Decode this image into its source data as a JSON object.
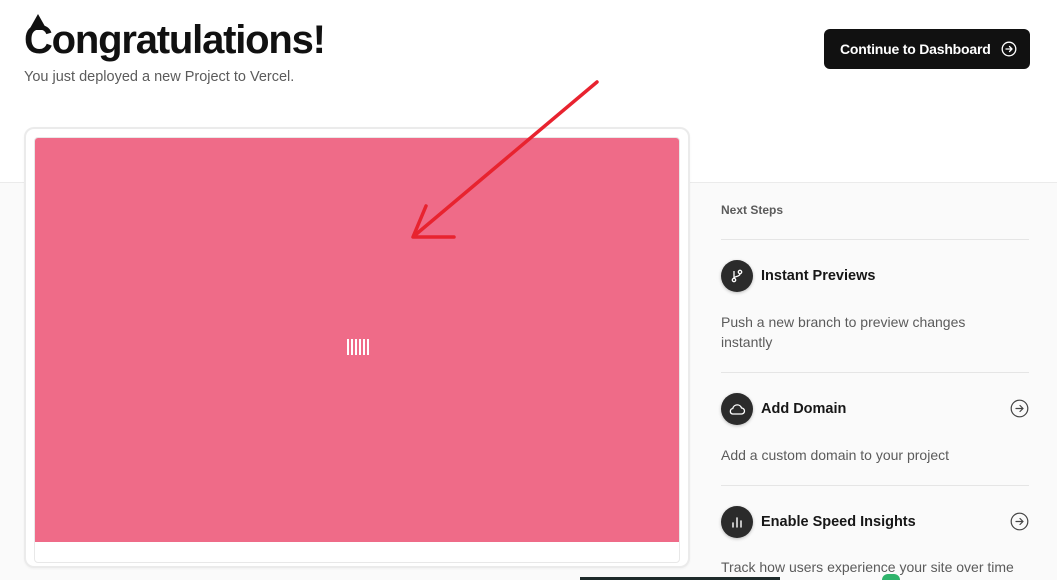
{
  "header": {
    "title": "Congratulations!",
    "subtitle": "You just deployed a new Project to Vercel.",
    "cta_label": "Continue to Dashboard"
  },
  "preview": {
    "background": "#ef6b88"
  },
  "next_steps": {
    "title": "Next Steps",
    "items": [
      {
        "label": "Instant Previews",
        "description": "Push a new branch to preview changes instantly",
        "icon": "git-branch-icon"
      },
      {
        "label": "Add Domain",
        "description": "Add a custom domain to your project",
        "icon": "cloud-icon"
      },
      {
        "label": "Enable Speed Insights",
        "description": "Track how users experience your site over time",
        "icon": "bar-chart-icon"
      }
    ]
  },
  "colors": {
    "accent_dark": "#111111",
    "annotation_arrow": "#e8232f"
  }
}
